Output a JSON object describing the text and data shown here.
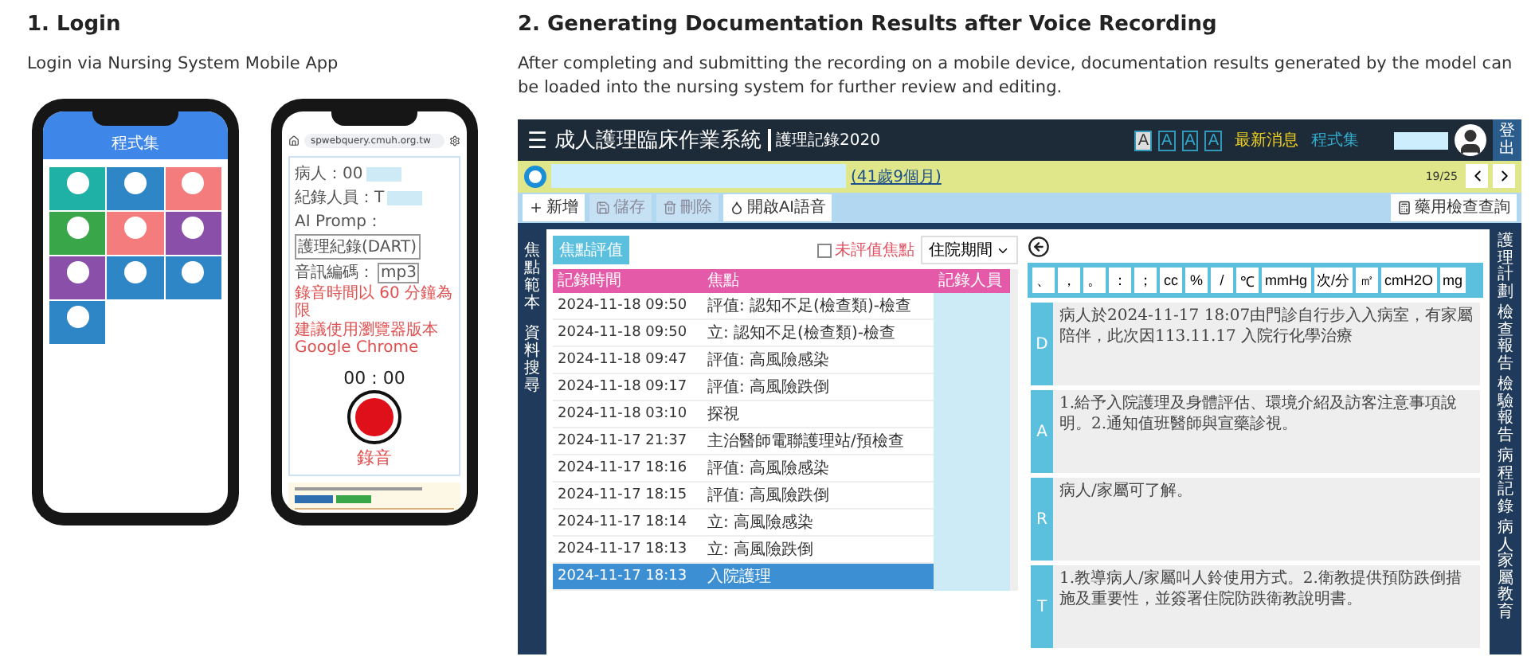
{
  "login": {
    "heading": "1. Login",
    "subtitle": "Login via Nursing System Mobile App",
    "menu_phone": {
      "title": "程式集",
      "tiles": [
        {
          "color": "#1fb0a6"
        },
        {
          "color": "#2f86c6"
        },
        {
          "color": "#f47c7c"
        },
        {
          "color": "#3aa64a"
        },
        {
          "color": "#f47c7c"
        },
        {
          "color": "#8a4fa8"
        },
        {
          "color": "#8a4fa8"
        },
        {
          "color": "#2f86c6"
        },
        {
          "color": "#2f86c6"
        },
        {
          "color": "#2f86c6"
        }
      ]
    },
    "recorder_phone": {
      "url": "spwebquery.cmuh.org.tw",
      "patient_label": "病人：00",
      "recorder_label": "紀錄人員：T",
      "prompt_label": "AI Promp：",
      "prompt_value": "護理紀錄(DART)",
      "encoding_label": "音訊編碼：",
      "encoding_value": "mp3",
      "notes": [
        "錄音時間以 60 分鐘為限",
        "建議使用瀏覽器版本 Google Chrome"
      ],
      "timer": "00 : 00",
      "record_label": "錄音"
    }
  },
  "generation": {
    "heading": "2. Generating Documentation Results after Voice Recording",
    "description": "After completing and submitting the recording on a mobile device, documentation results generated by the model can be loaded into the nursing system for further review and editing.",
    "app": {
      "menu_glyph": "☰",
      "title": "成人護理臨床作業系統",
      "subtitle": "護理記錄2020",
      "font_sizes": [
        {
          "label": "A",
          "selected": true
        },
        {
          "label": "A",
          "selected": false
        },
        {
          "label": "A",
          "selected": false
        },
        {
          "label": "A",
          "selected": false
        }
      ],
      "news_link": "最新消息",
      "programs_link": "程式集",
      "logout": "登出",
      "patient": {
        "age": "(41歲9個月)",
        "page": "19/25"
      },
      "toolbar": [
        {
          "kind": "add",
          "label": "新增",
          "disabled": false
        },
        {
          "kind": "save",
          "label": "儲存",
          "disabled": true
        },
        {
          "kind": "delete",
          "label": "刪除",
          "disabled": true
        },
        {
          "kind": "voice",
          "label": "開啟AI語音",
          "disabled": false
        }
      ],
      "toolbar_right": "藥用檢查查詢",
      "left_tabs": [
        "焦點範本",
        "資料搜尋"
      ],
      "focus_button": "焦點評值",
      "unevaluated": {
        "label": "未評值焦點",
        "checked": false
      },
      "period": "住院期間",
      "columns": [
        "記錄時間",
        "焦點",
        "記錄人員"
      ],
      "rows": [
        {
          "time": "2024-11-18 09:50",
          "focus": "評值: 認知不足(檢查類)-檢查",
          "selected": false
        },
        {
          "time": "2024-11-18 09:50",
          "focus": "立: 認知不足(檢查類)-檢查",
          "selected": false
        },
        {
          "time": "2024-11-18 09:47",
          "focus": "評值: 高風險感染",
          "selected": false
        },
        {
          "time": "2024-11-18 09:17",
          "focus": "評值: 高風險跌倒",
          "selected": false
        },
        {
          "time": "2024-11-18 03:10",
          "focus": "探視",
          "selected": false
        },
        {
          "time": "2024-11-17 21:37",
          "focus": "主治醫師電聯護理站/預檢查",
          "selected": false
        },
        {
          "time": "2024-11-17 18:16",
          "focus": "評值: 高風險感染",
          "selected": false
        },
        {
          "time": "2024-11-17 18:15",
          "focus": "評值: 高風險跌倒",
          "selected": false
        },
        {
          "time": "2024-11-17 18:14",
          "focus": "立: 高風險感染",
          "selected": false
        },
        {
          "time": "2024-11-17 18:13",
          "focus": "立: 高風險跌倒",
          "selected": false
        },
        {
          "time": "2024-11-17 18:13",
          "focus": "入院護理",
          "selected": true
        }
      ],
      "symbols": [
        "、",
        "，",
        "。",
        "：",
        "；",
        "cc",
        "%",
        "/",
        "℃",
        "mmHg",
        "次/分",
        "㎡",
        "cmH2O",
        "mg"
      ],
      "dart": [
        {
          "letter": "D",
          "text": "病人於2024-11-17 18:07由門診自行步入入病室，有家屬陪伴，此次因113.11.17 入院行化學治療"
        },
        {
          "letter": "A",
          "text": "1.給予入院護理及身體評估、環境介紹及訪客注意事項說明。2.通知值班醫師與宣藥診視。"
        },
        {
          "letter": "R",
          "text": "病人/家屬可了解。"
        },
        {
          "letter": "T",
          "text": "1.教導病人/家屬叫人鈴使用方式。2.衛教提供預防跌倒措施及重要性，並簽署住院防跌衛教說明書。"
        }
      ],
      "right_tabs": [
        "護理計劃",
        "檢查報告",
        "檢驗報告",
        "病程記錄",
        "病人家屬教育"
      ]
    }
  }
}
